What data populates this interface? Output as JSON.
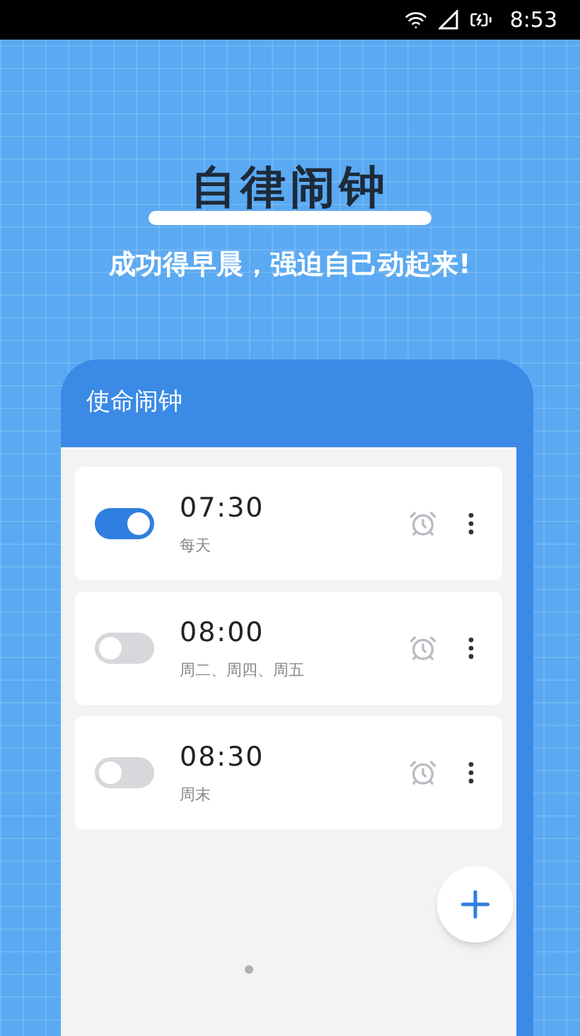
{
  "status_bar": {
    "time": "8:53"
  },
  "headline": "自律闹钟",
  "tagline": "成功得早晨，强迫自己动起来!",
  "app": {
    "title": "使命闹钟",
    "alarms": [
      {
        "time": "07:30",
        "repeat": "每天",
        "on": true
      },
      {
        "time": "08:00",
        "repeat": "周二、周四、周五",
        "on": false
      },
      {
        "time": "08:30",
        "repeat": "周末",
        "on": false
      }
    ]
  }
}
